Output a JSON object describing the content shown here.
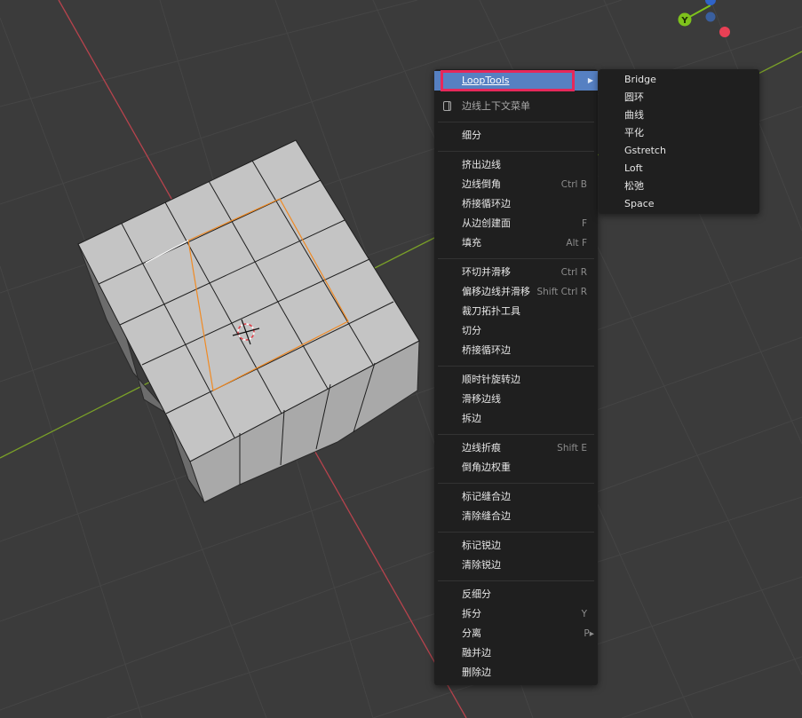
{
  "viewport": {
    "gizmo": {
      "y_label": "Y"
    }
  },
  "context_menu": {
    "header": "边线上下文菜单",
    "items": [
      {
        "label": "LoopTools",
        "shortcut": "",
        "submenu": true,
        "active": true
      },
      {
        "label": "细分",
        "shortcut": ""
      },
      {
        "label": "挤出边线",
        "shortcut": ""
      },
      {
        "label": "边线倒角",
        "shortcut": "Ctrl B"
      },
      {
        "label": "桥接循环边",
        "shortcut": ""
      },
      {
        "label": "从边创建面",
        "shortcut": "F"
      },
      {
        "label": "填充",
        "shortcut": "Alt F"
      },
      {
        "label": "环切并滑移",
        "shortcut": "Ctrl R"
      },
      {
        "label": "偏移边线并滑移",
        "shortcut": "Shift Ctrl R"
      },
      {
        "label": "裁刀拓扑工具",
        "shortcut": ""
      },
      {
        "label": "切分",
        "shortcut": ""
      },
      {
        "label": "桥接循环边",
        "shortcut": ""
      },
      {
        "label": "顺时针旋转边",
        "shortcut": ""
      },
      {
        "label": "滑移边线",
        "shortcut": ""
      },
      {
        "label": "拆边",
        "shortcut": ""
      },
      {
        "label": "边线折痕",
        "shortcut": "Shift E"
      },
      {
        "label": "倒角边权重",
        "shortcut": ""
      },
      {
        "label": "标记缝合边",
        "shortcut": ""
      },
      {
        "label": "清除缝合边",
        "shortcut": ""
      },
      {
        "label": "标记锐边",
        "shortcut": ""
      },
      {
        "label": "清除锐边",
        "shortcut": ""
      },
      {
        "label": "反细分",
        "shortcut": ""
      },
      {
        "label": "拆分",
        "shortcut": "Y"
      },
      {
        "label": "分离",
        "shortcut": "P▸"
      },
      {
        "label": "融并边",
        "shortcut": ""
      },
      {
        "label": "删除边",
        "shortcut": ""
      }
    ]
  },
  "looptools_submenu": {
    "items": [
      "Bridge",
      "圆环",
      "曲线",
      "平化",
      "Gstretch",
      "Loft",
      "松弛",
      "Space"
    ]
  },
  "colors": {
    "background": "#3b3b3b",
    "menu_bg": "#1f1f1f",
    "active_item": "#5680c2",
    "highlight_border": "#e6285a",
    "x_axis": "#c8454f",
    "y_axis": "#7aa028",
    "selected_edge": "#f08a24",
    "gizmo_y": "#7ec21c",
    "gizmo_z": "#2f63c8",
    "gizmo_x": "#e84055"
  }
}
